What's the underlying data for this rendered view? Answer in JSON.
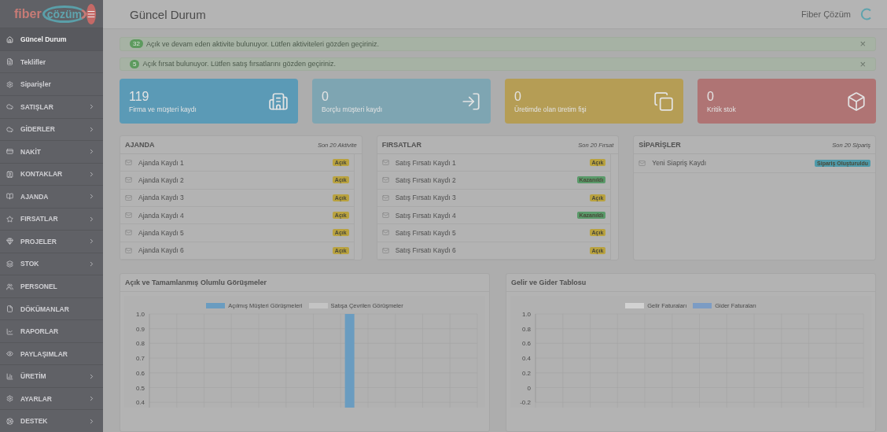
{
  "logo": {
    "part_1": "fiber",
    "part_2": "çözüm"
  },
  "header": {
    "title": "Güncel Durum",
    "user": "Fiber Çözüm"
  },
  "sidebar": {
    "items": [
      {
        "label": "Güncel Durum",
        "selected": true,
        "expandable": false
      },
      {
        "label": "Teklifler",
        "selected": false,
        "expandable": false
      },
      {
        "label": "Siparişler",
        "selected": false,
        "expandable": false
      },
      {
        "label": "SATIŞLAR",
        "selected": false,
        "expandable": true
      },
      {
        "label": "GİDERLER",
        "selected": false,
        "expandable": true
      },
      {
        "label": "NAKİT",
        "selected": false,
        "expandable": true
      },
      {
        "label": "KONTAKLAR",
        "selected": false,
        "expandable": true
      },
      {
        "label": "AJANDA",
        "selected": false,
        "expandable": true
      },
      {
        "label": "FIRSATLAR",
        "selected": false,
        "expandable": true
      },
      {
        "label": "PROJELER",
        "selected": false,
        "expandable": true
      },
      {
        "label": "STOK",
        "selected": false,
        "expandable": true
      },
      {
        "label": "PERSONEL",
        "selected": false,
        "expandable": false
      },
      {
        "label": "DÖKÜMANLAR",
        "selected": false,
        "expandable": false
      },
      {
        "label": "RAPORLAR",
        "selected": false,
        "expandable": false
      },
      {
        "label": "PAYLAŞIMLAR",
        "selected": false,
        "expandable": false
      },
      {
        "label": "ÜRETİM",
        "selected": false,
        "expandable": true
      },
      {
        "label": "AYARLAR",
        "selected": false,
        "expandable": true
      },
      {
        "label": "DESTEK",
        "selected": false,
        "expandable": true
      }
    ]
  },
  "alerts": [
    {
      "count": "32",
      "text": "Açık ve devam eden aktivite bulunuyor. Lütfen aktiviteleri gözden geçiriniz.",
      "close": "×"
    },
    {
      "count": "5",
      "text": "Açık fırsat bulunuyor. Lütfen satış fırsatlarını gözden geçiriniz.",
      "close": "×"
    }
  ],
  "stat_cards": [
    {
      "value": "119",
      "label": "Firma ve müşteri kaydı",
      "color": "#5b9ab6"
    },
    {
      "value": "0",
      "label": "Borçlu müşteri kaydı",
      "color": "#7ea5b2"
    },
    {
      "value": "0",
      "label": "Üretimde olan üretim fişi",
      "color": "#b59d55"
    },
    {
      "value": "0",
      "label": "Kritik stok",
      "color": "#af7474"
    }
  ],
  "panels": [
    {
      "title": "AJANDA",
      "subtitle": "Son 20 Aktivite",
      "items": [
        {
          "label": "Ajanda Kaydı 1",
          "status": "Açık",
          "kind": "open"
        },
        {
          "label": "Ajanda Kaydı 2",
          "status": "Açık",
          "kind": "open"
        },
        {
          "label": "Ajanda Kaydı 3",
          "status": "Açık",
          "kind": "open"
        },
        {
          "label": "Ajanda Kaydı 4",
          "status": "Açık",
          "kind": "open"
        },
        {
          "label": "Ajanda Kaydı 5",
          "status": "Açık",
          "kind": "open"
        },
        {
          "label": "Ajanda Kaydı 6",
          "status": "Açık",
          "kind": "open"
        }
      ]
    },
    {
      "title": "FIRSATLAR",
      "subtitle": "Son 20 Fırsat",
      "items": [
        {
          "label": "Satış Fırsatı Kaydı 1",
          "status": "Açık",
          "kind": "open"
        },
        {
          "label": "Satış Fırsatı Kaydı 2",
          "status": "Kazanıldı",
          "kind": "won"
        },
        {
          "label": "Satış Fırsatı Kaydı 3",
          "status": "Açık",
          "kind": "open"
        },
        {
          "label": "Satış Fırsatı Kaydı 4",
          "status": "Kazanıldı",
          "kind": "won"
        },
        {
          "label": "Satış Fırsatı Kaydı 5",
          "status": "Açık",
          "kind": "open"
        },
        {
          "label": "Satış Fırsatı Kaydı 6",
          "status": "Açık",
          "kind": "open"
        }
      ]
    },
    {
      "title": "SİPARİŞLER",
      "subtitle": "Son 20 Sipariş",
      "items": [
        {
          "label": "Yeni Siapriş Kaydı",
          "status": "Sipariş Oluşturuldu",
          "kind": "created"
        }
      ]
    }
  ],
  "charts": [
    {
      "title": "Açık ve Tamamlanmış Olumlu Görüşmeler",
      "chart_data": {
        "type": "bar",
        "grid": true,
        "ylim": [
          0,
          1
        ],
        "yticks": [
          {
            "value": 1,
            "label": "1.0"
          },
          0.9,
          0.8,
          0.7,
          0.6,
          0.5,
          0.4
        ],
        "series": [
          {
            "name": "Açılmış Müşteri Görüşmeleri",
            "color": "#6a9cc0",
            "values": [
              null,
              null,
              null,
              null,
              null,
              null,
              null,
              1,
              null,
              null,
              null,
              null
            ]
          },
          {
            "name": "Satışa Çevrilen Görüşmeler",
            "color": "#c4c4c4"
          }
        ]
      }
    },
    {
      "title": "Gelir ve Gider Tablosu",
      "chart_data": {
        "type": "line",
        "grid": true,
        "ylim": [
          -0.2,
          1
        ],
        "yticks": [
          {
            "value": 1,
            "label": "1.0"
          },
          0.8,
          0.6,
          0.4,
          0.2,
          0,
          -0.2
        ],
        "series": [
          {
            "name": "Gelir Faturaları",
            "color": "#d2d2d2"
          },
          {
            "name": "Gider Faturaları",
            "color": "#7c9cc4"
          }
        ]
      }
    }
  ]
}
